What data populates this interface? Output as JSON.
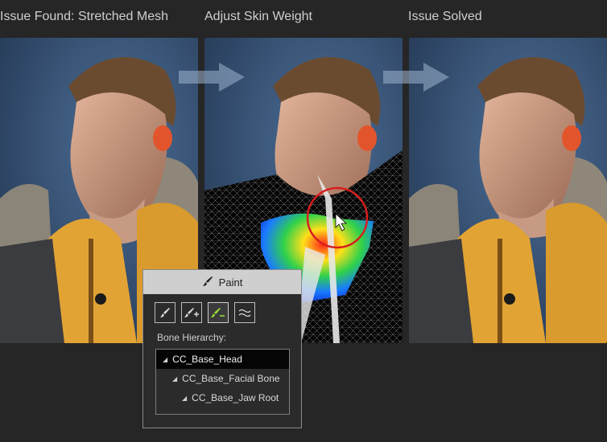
{
  "panels": [
    {
      "title": "Issue Found: Stretched Mesh"
    },
    {
      "title": "Adjust Skin Weight"
    },
    {
      "title": "Issue Solved"
    }
  ],
  "paint_panel": {
    "title": "Paint",
    "header_icon": "paint-brush-icon",
    "tools": [
      {
        "icon": "brush-icon",
        "active": false
      },
      {
        "icon": "brush-add-icon",
        "active": false
      },
      {
        "icon": "brush-subtract-icon",
        "active": true
      },
      {
        "icon": "smooth-icon",
        "active": false
      }
    ],
    "bone_hierarchy_label": "Bone Hierarchy:",
    "bones": [
      {
        "label": "CC_Base_Head",
        "depth": 0,
        "selected": true
      },
      {
        "label": "CC_Base_Facial Bone",
        "depth": 1,
        "selected": false
      },
      {
        "label": "CC_Base_Jaw Root",
        "depth": 2,
        "selected": false
      }
    ]
  },
  "colors": {
    "background": "#262626",
    "jacket": "#e2a335",
    "accent_green": "#9be23c",
    "highlight_circle": "#d81e1e"
  }
}
